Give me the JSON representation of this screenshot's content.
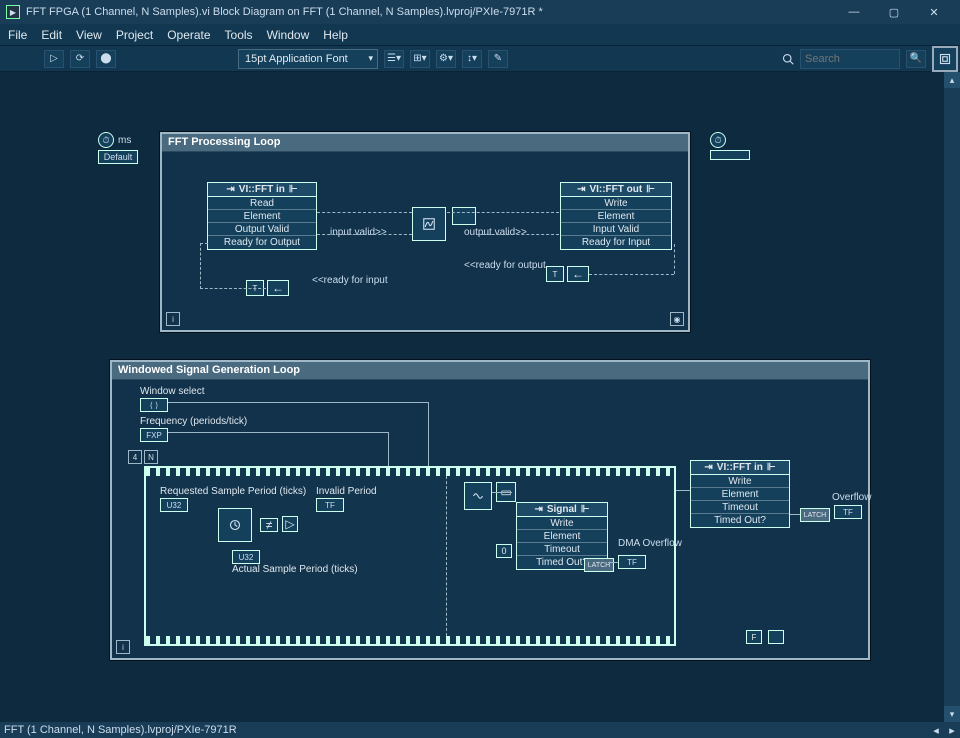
{
  "window": {
    "title": "FFT FPGA (1 Channel, N Samples).vi Block Diagram on FFT (1 Channel, N Samples).lvproj/PXIe-7971R *",
    "minimize": "—",
    "maximize": "▢",
    "close": "✕"
  },
  "menu": {
    "file": "File",
    "edit": "Edit",
    "view": "View",
    "project": "Project",
    "operate": "Operate",
    "tools": "Tools",
    "window": "Window",
    "help": "Help"
  },
  "toolbar": {
    "run": "▷",
    "run_cont": "⟳",
    "abort": "⬤",
    "font": "15pt Application Font",
    "search_placeholder": "Search",
    "help": "?"
  },
  "statusbar": {
    "path": "FFT (1 Channel, N Samples).lvproj/PXIe-7971R"
  },
  "canvas": {
    "ms_label": "ms",
    "default_label": "Default",
    "loop1": {
      "title": "FFT Processing Loop",
      "fft_in": {
        "name": "VI::FFT in",
        "r0": "Read",
        "r1": "Element",
        "r2": "Output Valid",
        "r3": "Ready for Output"
      },
      "fft_out": {
        "name": "VI::FFT out",
        "r0": "Write",
        "r1": "Element",
        "r2": "Input Valid",
        "r3": "Ready for Input"
      },
      "input_valid": "input valid>>",
      "output_valid": "output valid>>",
      "ready_for_output": "<<ready for output",
      "ready_for_input": "<<ready for input"
    },
    "loop2": {
      "title": "Windowed Signal Generation Loop",
      "window_select": "Window select",
      "frequency": "Frequency (periods/tick)",
      "requested": "Requested Sample Period (ticks)",
      "actual": "Actual Sample Period (ticks)",
      "invalid_period": "Invalid Period",
      "signal": {
        "name": "Signal",
        "r0": "Write",
        "r1": "Element",
        "r2": "Timeout",
        "r3": "Timed Out?"
      },
      "dma_overflow": "DMA Overflow",
      "fft_in2": {
        "name": "VI::FFT in",
        "r0": "Write",
        "r1": "Element",
        "r2": "Timeout",
        "r3": "Timed Out?"
      },
      "overflow": "Overflow",
      "zero": "0",
      "four": "4",
      "n": "N",
      "latch1": "LATCH",
      "latch2": "LATCH",
      "u32a": "U32",
      "u32b": "U32",
      "tf1": "TF",
      "tf2": "TF",
      "tf3": "TF",
      "fxp": "FXP",
      "enum_ctl": "⟨ ⟩"
    }
  }
}
